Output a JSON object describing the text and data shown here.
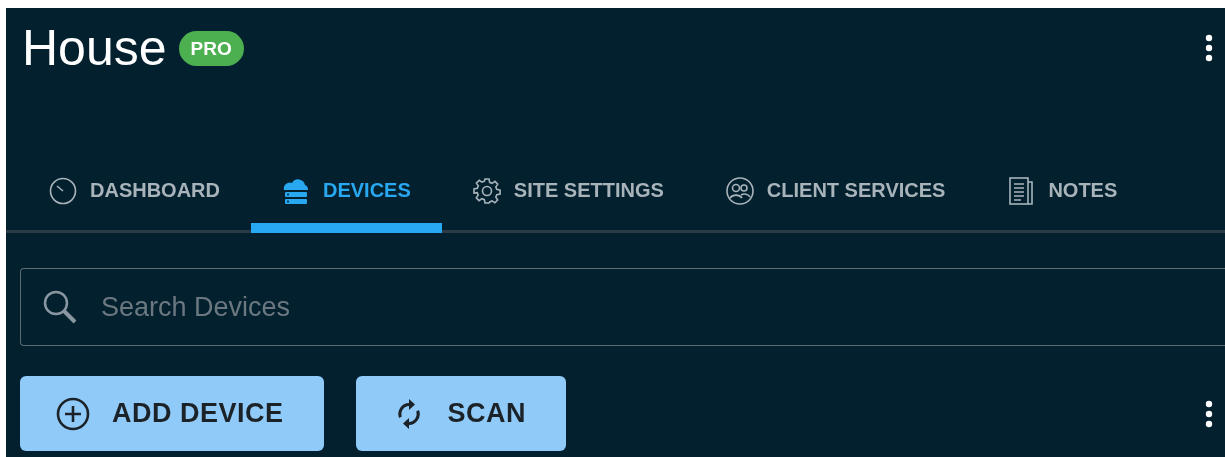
{
  "header": {
    "title": "House",
    "badge": "PRO"
  },
  "tabs": [
    {
      "label": "DASHBOARD",
      "selected": false
    },
    {
      "label": "DEVICES",
      "selected": true
    },
    {
      "label": "SITE SETTINGS",
      "selected": false
    },
    {
      "label": "CLIENT SERVICES",
      "selected": false
    },
    {
      "label": "NOTES",
      "selected": false
    }
  ],
  "search": {
    "placeholder": "Search Devices"
  },
  "buttons": [
    {
      "label": "ADD DEVICE"
    },
    {
      "label": "SCAN"
    }
  ]
}
